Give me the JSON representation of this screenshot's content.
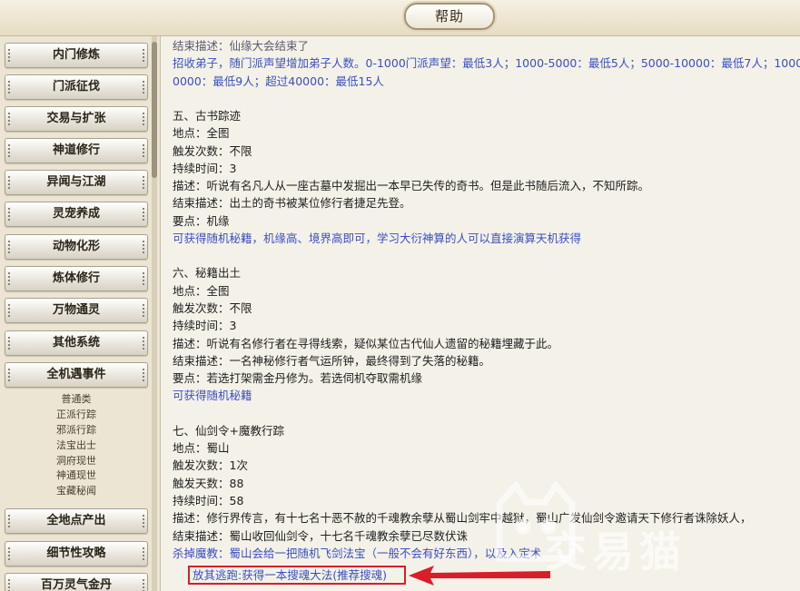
{
  "window": {
    "title": "帮助"
  },
  "sidebar": {
    "items": [
      {
        "label": "内门修炼"
      },
      {
        "label": "门派征伐"
      },
      {
        "label": "交易与扩张"
      },
      {
        "label": "神道修行"
      },
      {
        "label": "异闻与江湖"
      },
      {
        "label": "灵宠养成"
      },
      {
        "label": "动物化形"
      },
      {
        "label": "炼体修行"
      },
      {
        "label": "万物通灵"
      },
      {
        "label": "其他系统"
      },
      {
        "label": "全机遇事件"
      }
    ],
    "subitems": [
      "普通类",
      "正派行踪",
      "邪派行踪",
      "法宝出士",
      "洞府现世",
      "神通现世",
      "宝藏秘闻"
    ],
    "bottom_items": [
      {
        "label": "全地点产出"
      },
      {
        "label": "细节性攻略"
      },
      {
        "label": "百万灵气金丹"
      }
    ]
  },
  "content": {
    "lines": [
      {
        "text": "结束描述：仙缘大会结束了",
        "style": "gray"
      },
      {
        "text": "招收弟子，随门派声望增加弟子人数。0-1000门派声望：最低3人；1000-5000：最低5人；5000-10000：最低7人；10000-4",
        "style": "blue"
      },
      {
        "text": "0000：最低9人；超过40000：最低15人",
        "style": "blue"
      },
      {
        "text": "",
        "style": ""
      },
      {
        "text": "五、古书踪迹",
        "style": ""
      },
      {
        "text": "地点：全图",
        "style": ""
      },
      {
        "text": "触发次数：不限",
        "style": ""
      },
      {
        "text": "持续时间：3",
        "style": ""
      },
      {
        "text": "描述：听说有名凡人从一座古墓中发掘出一本早已失传的奇书。但是此书随后流入，不知所踪。",
        "style": ""
      },
      {
        "text": "结束描述：出土的奇书被某位修行者捷足先登。",
        "style": ""
      },
      {
        "text": "要点：机缘",
        "style": ""
      },
      {
        "text": "可获得随机秘籍，机缘高、境界高即可，学习大衍神算的人可以直接演算天机获得",
        "style": "blue"
      },
      {
        "text": "",
        "style": ""
      },
      {
        "text": "六、秘籍出土",
        "style": ""
      },
      {
        "text": "地点：全图",
        "style": ""
      },
      {
        "text": "触发次数：不限",
        "style": ""
      },
      {
        "text": "持续时间：3",
        "style": ""
      },
      {
        "text": "描述：听说有名修行者在寻得线索，疑似某位古代仙人遗留的秘籍埋藏于此。",
        "style": ""
      },
      {
        "text": "结束描述：一名神秘修行者气运所钟，最终得到了失落的秘籍。",
        "style": ""
      },
      {
        "text": "要点：若选打架需金丹修为。若选伺机夺取需机缘",
        "style": ""
      },
      {
        "text": "可获得随机秘籍",
        "style": "blue"
      },
      {
        "text": "",
        "style": ""
      },
      {
        "text": "七、仙剑令+魔教行踪",
        "style": ""
      },
      {
        "text": "地点：蜀山",
        "style": ""
      },
      {
        "text": "触发次数：1次",
        "style": ""
      },
      {
        "text": "触发天数：88",
        "style": ""
      },
      {
        "text": "持续时间：58",
        "style": ""
      },
      {
        "text": "描述：修行界传言，有十七名十恶不赦的千魂教余孽从蜀山剑牢中越狱，蜀山广发仙剑令邀请天下修行者诛除妖人，",
        "style": ""
      },
      {
        "text": "结束描述：蜀山收回仙剑令，十七名千魂教余孽已尽数伏诛",
        "style": ""
      },
      {
        "text": "杀掉魔教：蜀山会给一把随机飞剑法宝（一般不会有好东西），以及入定术",
        "style": "blue"
      }
    ],
    "highlight": "放其逃跑:获得一本搜魂大法(推荐搜魂)"
  },
  "watermark": {
    "text": "交易猫"
  },
  "colors": {
    "link_blue": "#3a4fc0",
    "highlight_red": "#d81e2a",
    "panel_bg": "#f4f1e8"
  }
}
